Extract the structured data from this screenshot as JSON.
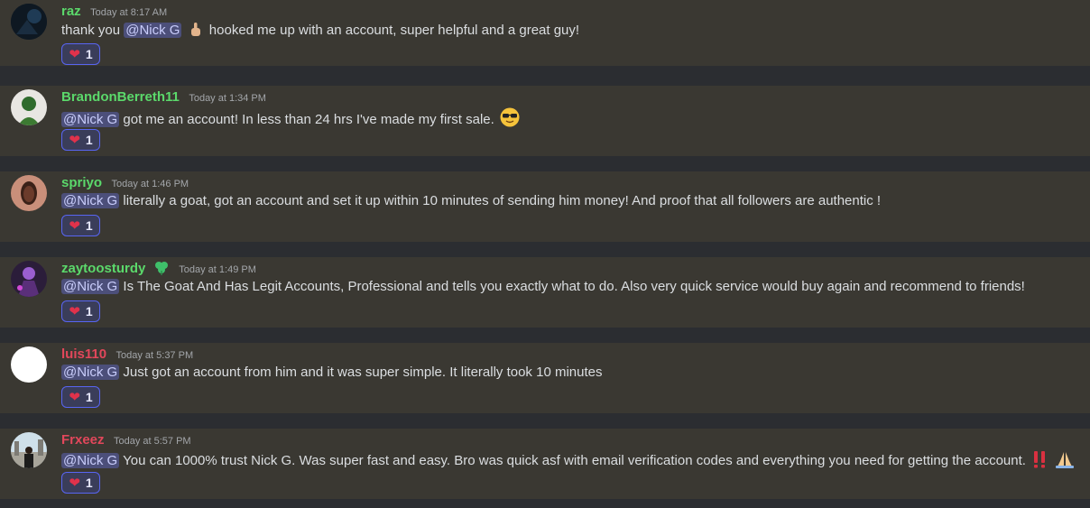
{
  "messages": [
    {
      "username": "raz",
      "name_color": "#5bd96b",
      "timestamp": "Today at 8:17 AM",
      "text_before": "thank you",
      "mention": "@Nick G",
      "text_after": "hooked me up with an account, super helpful and a great guy!",
      "reaction_emoji": "heart-icon",
      "reaction_count": "1"
    },
    {
      "username": "BrandonBerreth11",
      "name_color": "#5bd96b",
      "timestamp": "Today at 1:34 PM",
      "mention": "@Nick G",
      "text": "got me an account! In less than 24 hrs I've made my first sale.",
      "reaction_count": "1"
    },
    {
      "username": "spriyo",
      "name_color": "#5bd96b",
      "timestamp": "Today at 1:46 PM",
      "mention": "@Nick G",
      "text": "literally a goat, got an account and set it up within 10 minutes of sending him money! And proof that all followers are authentic !",
      "reaction_count": "1"
    },
    {
      "username": "zaytoosturdy",
      "name_color": "#5bd96b",
      "timestamp": "Today at 1:49 PM",
      "mention": "@Nick G",
      "text": "Is The Goat And Has Legit Accounts, Professional and tells you exactly what to do. Also very quick service would buy again and recommend to friends!",
      "reaction_count": "1"
    },
    {
      "username": "luis110",
      "name_color": "#e2475b",
      "timestamp": "Today at 5:37 PM",
      "mention": "@Nick G",
      "text": "Just got an account from him and it was super simple. It literally took 10 minutes",
      "reaction_count": "1"
    },
    {
      "username": "Frxeez",
      "name_color": "#e2475b",
      "timestamp": "Today at 5:57 PM",
      "mention": "@Nick G",
      "text": "You can 1000% trust Nick G. Was super fast and easy. Bro was quick asf with email verification codes and everything you need for getting the account.",
      "reaction_count": "1"
    }
  ]
}
